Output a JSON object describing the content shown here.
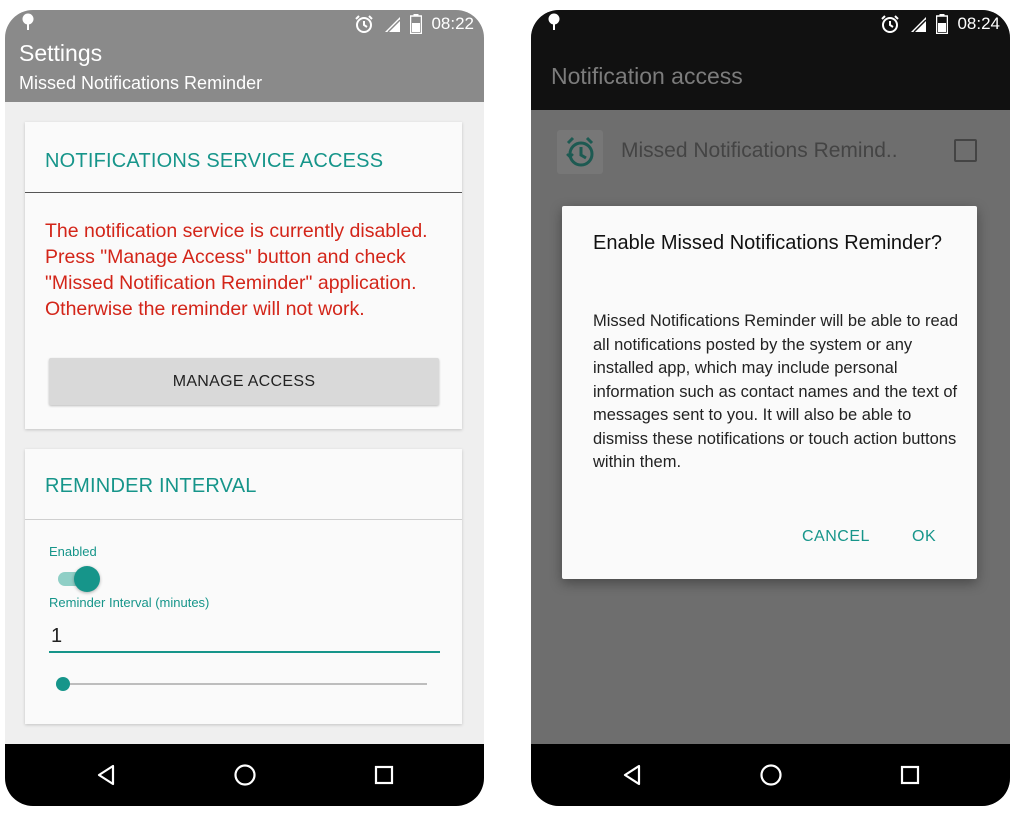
{
  "left_phone": {
    "status": {
      "time": "08:22"
    },
    "appbar": {
      "title": "Settings",
      "subtitle": "Missed Notifications Reminder"
    },
    "access_card": {
      "title": "NOTIFICATIONS SERVICE ACCESS",
      "warning": "The notification service is currently disabled. Press \"Manage Access\" button and check \"Missed Notification Reminder\" application. Otherwise the reminder will not work.",
      "button_label": "MANAGE ACCESS"
    },
    "interval_card": {
      "title": "REMINDER INTERVAL",
      "enabled_label": "Enabled",
      "enabled": true,
      "interval_label": "Reminder Interval (minutes)",
      "interval_value": "1",
      "slider_fraction": 0.0
    }
  },
  "right_phone": {
    "status": {
      "time": "08:24"
    },
    "appbar": {
      "title": "Notification access"
    },
    "list_item": {
      "label": "Missed Notifications Remind..",
      "checked": false
    },
    "dialog": {
      "title": "Enable Missed Notifications Reminder?",
      "body": "Missed Notifications Reminder will be able to read all notifications posted by the system or any installed app, which may include personal information such as contact names and the text of messages sent to you. It will also be able to dismiss these notifications or touch action buttons within them.",
      "cancel_label": "CANCEL",
      "ok_label": "OK"
    }
  },
  "icons": {
    "status_left": "notification-pin-icon",
    "status_right": [
      "alarm-icon",
      "signal-icon",
      "battery-icon"
    ],
    "nav": [
      "back-icon",
      "home-icon",
      "recents-icon"
    ],
    "app": "alarm-history-icon"
  },
  "colors": {
    "accent": "#16958a",
    "warning": "#d32519",
    "appbar_left": "#8a8a8a",
    "appbar_right": "#111111"
  }
}
